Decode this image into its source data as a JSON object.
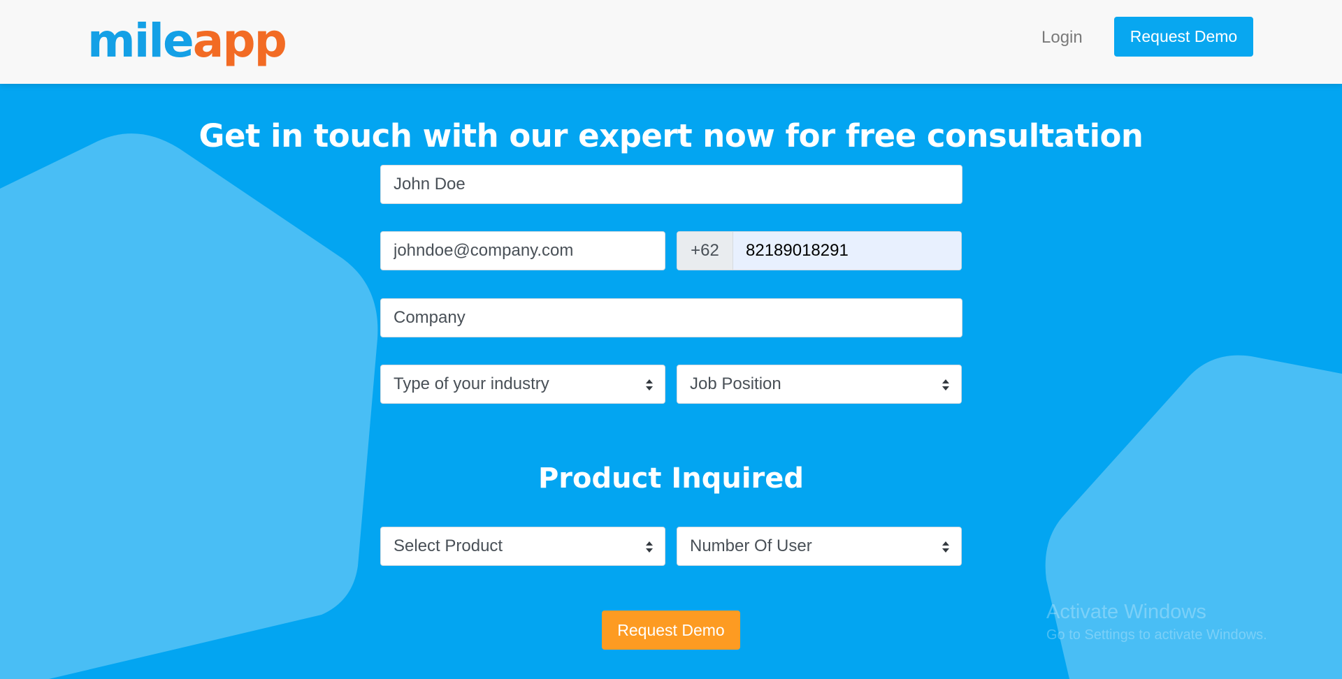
{
  "header": {
    "logo": {
      "part1": "mile",
      "part2": "app"
    },
    "nav": {
      "login_label": "Login",
      "request_demo_label": "Request Demo"
    }
  },
  "hero": {
    "headline": "Get in touch with our expert now for free consultation"
  },
  "form": {
    "name": {
      "value": "John Doe"
    },
    "email": {
      "value": "johndoe@company.com"
    },
    "phone": {
      "prefix": "+62",
      "value": "82189018291"
    },
    "company": {
      "placeholder": "Company"
    },
    "industry": {
      "selected": "Type of your industry"
    },
    "job_position": {
      "selected": "Job Position"
    },
    "product_section_title": "Product Inquired",
    "product": {
      "selected": "Select Product"
    },
    "users": {
      "selected": "Number Of User"
    },
    "submit_label": "Request Demo"
  },
  "watermark": {
    "title": "Activate Windows",
    "subtitle": "Go to Settings to activate Windows."
  },
  "colors": {
    "brand_blue": "#03a5f1",
    "logo_blue": "#14a0e6",
    "logo_orange": "#f26b24",
    "button_orange": "#fd9b22",
    "header_bg": "#f8f8f8"
  },
  "icons": {
    "select_indicator": "sort-icon"
  }
}
